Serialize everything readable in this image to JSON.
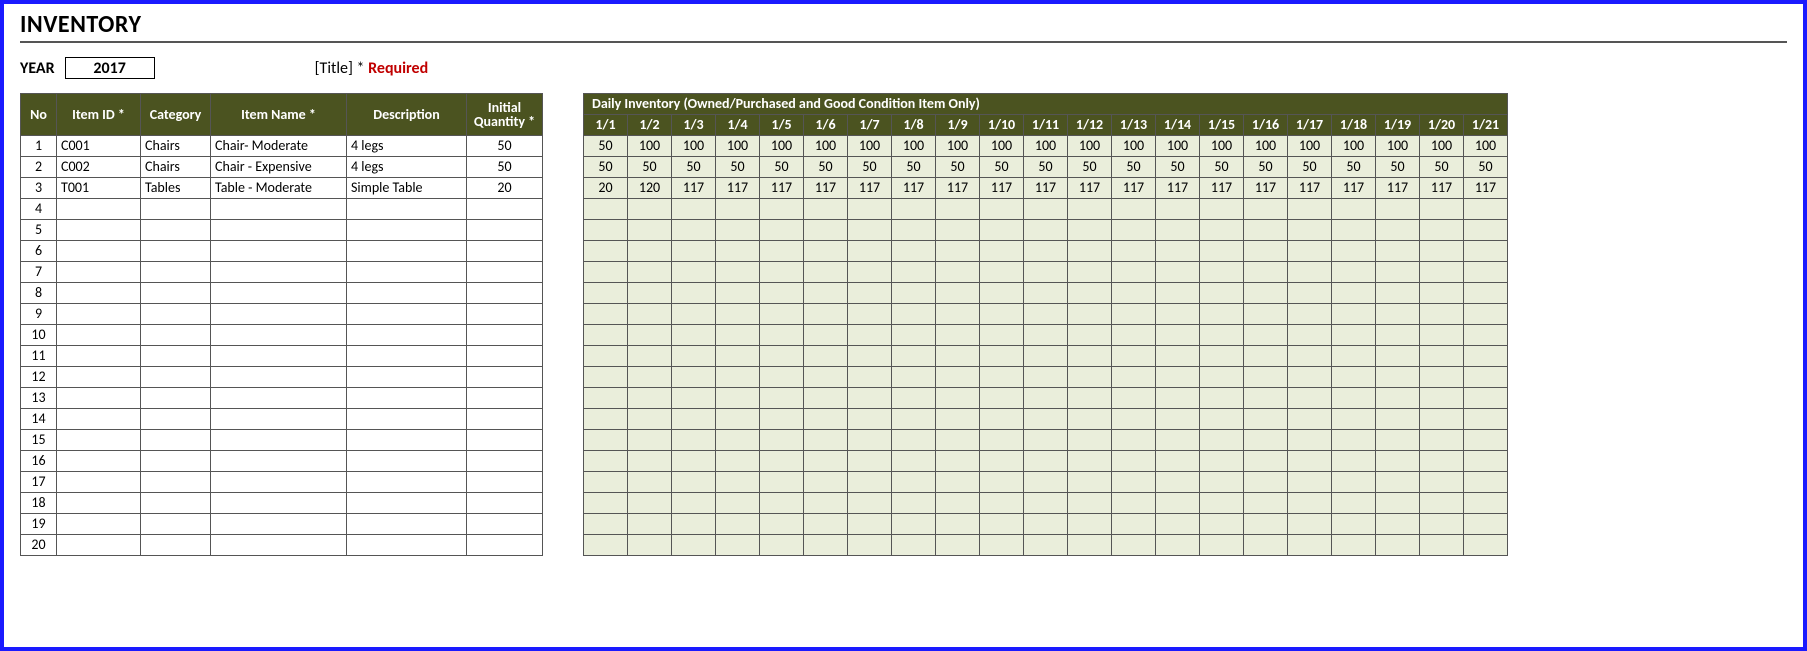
{
  "title": "INVENTORY",
  "meta": {
    "year_label": "YEAR",
    "year_value": "2017",
    "title_hint": "[Title] *",
    "required_label": "Required"
  },
  "left_headers": {
    "no": "No",
    "item_id": "Item ID *",
    "category": "Category",
    "item_name": "Item Name *",
    "description": "Description",
    "initial_qty_l1": "Initial",
    "initial_qty_l2": "Quantity *"
  },
  "rows": [
    {
      "no": 1,
      "item_id": "C001",
      "category": "Chairs",
      "item_name": "Chair- Moderate",
      "description": "4 legs",
      "initial_qty": 50
    },
    {
      "no": 2,
      "item_id": "C002",
      "category": "Chairs",
      "item_name": "Chair - Expensive",
      "description": "4 legs",
      "initial_qty": 50
    },
    {
      "no": 3,
      "item_id": "T001",
      "category": "Tables",
      "item_name": "Table - Moderate",
      "description": "Simple Table",
      "initial_qty": 20
    }
  ],
  "total_rows": 20,
  "daily": {
    "super_header": "Daily Inventory (Owned/Purchased and Good Condition Item Only)",
    "dates": [
      "1/1",
      "1/2",
      "1/3",
      "1/4",
      "1/5",
      "1/6",
      "1/7",
      "1/8",
      "1/9",
      "1/10",
      "1/11",
      "1/12",
      "1/13",
      "1/14",
      "1/15",
      "1/16",
      "1/17",
      "1/18",
      "1/19",
      "1/20",
      "1/21"
    ],
    "values": [
      [
        50,
        100,
        100,
        100,
        100,
        100,
        100,
        100,
        100,
        100,
        100,
        100,
        100,
        100,
        100,
        100,
        100,
        100,
        100,
        100,
        100
      ],
      [
        50,
        50,
        50,
        50,
        50,
        50,
        50,
        50,
        50,
        50,
        50,
        50,
        50,
        50,
        50,
        50,
        50,
        50,
        50,
        50,
        50
      ],
      [
        20,
        120,
        117,
        117,
        117,
        117,
        117,
        117,
        117,
        117,
        117,
        117,
        117,
        117,
        117,
        117,
        117,
        117,
        117,
        117,
        117
      ]
    ]
  }
}
